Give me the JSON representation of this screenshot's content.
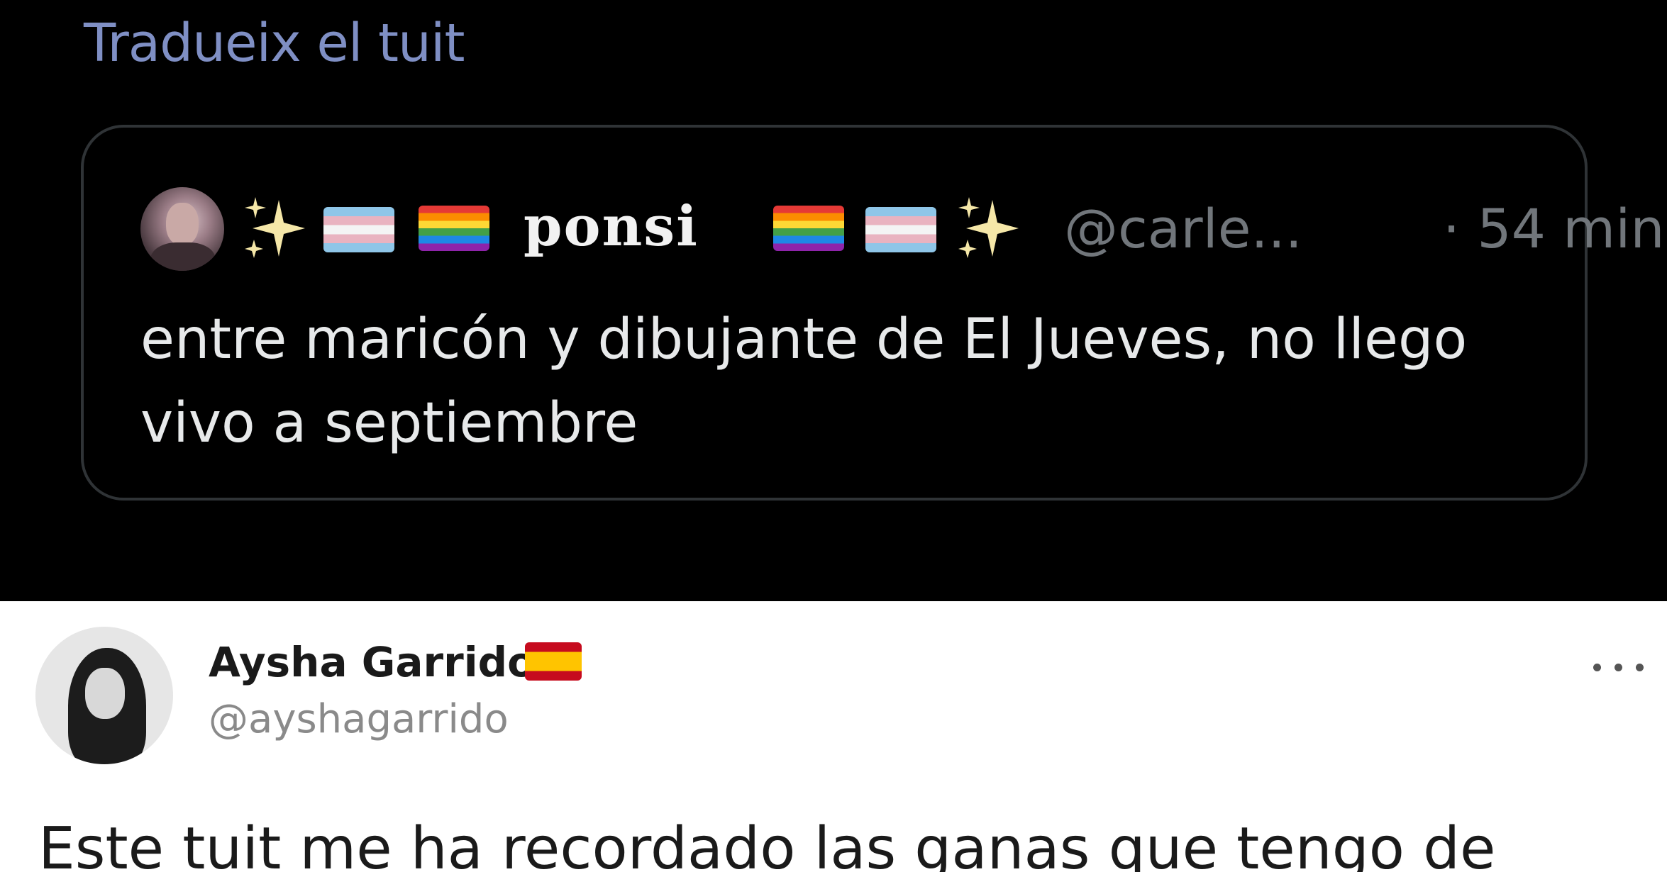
{
  "translate_link": "Tradueix el tuit",
  "quoted_tweet": {
    "display_name": "ponsi",
    "handle": "@carle...",
    "time": "· 54 min",
    "text": "entre maricón y dibujante de El Jueves, no llego vivo a septiembre",
    "name_decorations": [
      "sparkles-icon",
      "transgender-flag-icon",
      "rainbow-flag-icon",
      "rainbow-flag-icon",
      "transgender-flag-icon",
      "sparkles-icon"
    ]
  },
  "tweet": {
    "display_name": "Aysha Garrido",
    "handle": "@ayshagarrido",
    "name_flag": "spain-flag-icon",
    "more_icon": "more-options-icon",
    "text": "Este tuit me ha recordado las ganas que tengo de"
  },
  "colors": {
    "dark_background": "#000000",
    "light_background": "#ffffff",
    "link": "#7f8fc4",
    "muted": "#71767b",
    "card_border": "#2f3336"
  }
}
